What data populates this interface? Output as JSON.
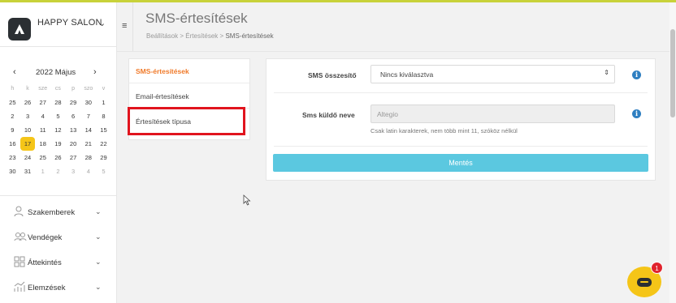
{
  "brand": {
    "name": "HAPPY SALON"
  },
  "calendar": {
    "title": "2022 Május",
    "weekdays": [
      "h",
      "k",
      "sze",
      "cs",
      "p",
      "szo",
      "v"
    ],
    "days": [
      {
        "d": "25",
        "muted": false
      },
      {
        "d": "26",
        "muted": false
      },
      {
        "d": "27",
        "muted": false
      },
      {
        "d": "28",
        "muted": false
      },
      {
        "d": "29",
        "muted": false
      },
      {
        "d": "30",
        "muted": false
      },
      {
        "d": "1",
        "muted": false
      },
      {
        "d": "2"
      },
      {
        "d": "3"
      },
      {
        "d": "4"
      },
      {
        "d": "5"
      },
      {
        "d": "6"
      },
      {
        "d": "7"
      },
      {
        "d": "8"
      },
      {
        "d": "9"
      },
      {
        "d": "10"
      },
      {
        "d": "11"
      },
      {
        "d": "12"
      },
      {
        "d": "13"
      },
      {
        "d": "14"
      },
      {
        "d": "15"
      },
      {
        "d": "16"
      },
      {
        "d": "17",
        "today": true
      },
      {
        "d": "18"
      },
      {
        "d": "19"
      },
      {
        "d": "20"
      },
      {
        "d": "21"
      },
      {
        "d": "22"
      },
      {
        "d": "23"
      },
      {
        "d": "24"
      },
      {
        "d": "25"
      },
      {
        "d": "26"
      },
      {
        "d": "27"
      },
      {
        "d": "28"
      },
      {
        "d": "29"
      },
      {
        "d": "30"
      },
      {
        "d": "31"
      },
      {
        "d": "1",
        "muted": true
      },
      {
        "d": "2",
        "muted": true
      },
      {
        "d": "3",
        "muted": true
      },
      {
        "d": "4",
        "muted": true
      },
      {
        "d": "5",
        "muted": true
      }
    ]
  },
  "nav": {
    "items": [
      {
        "label": "Szakemberek",
        "icon": "person-icon"
      },
      {
        "label": "Vendégek",
        "icon": "people-icon"
      },
      {
        "label": "Áttekintés",
        "icon": "grid-icon"
      },
      {
        "label": "Elemzések",
        "icon": "analytics-icon"
      }
    ]
  },
  "header": {
    "title": "SMS-értesítések",
    "breadcrumb": [
      "Beállítások",
      "Értesítések",
      "SMS-értesítések"
    ],
    "separator": ">"
  },
  "settings_menu": {
    "items": [
      "SMS-értesítések",
      "Email-értesítések",
      "Értesítések típusa"
    ],
    "active_index": 0
  },
  "form": {
    "sms_summary_label": "SMS összesítő",
    "sms_summary_value": "Nincs kiválasztva",
    "sender_name_label": "Sms küldő neve",
    "sender_name_value": "Altegio",
    "sender_name_hint": "Csak latin karakterek, nem több mint 11, szóköz nélkül",
    "save_label": "Mentés"
  },
  "chat": {
    "badge": "1"
  },
  "colors": {
    "accent_orange": "#f07a2a",
    "save_button": "#5bc8e0",
    "today": "#f5c518",
    "info": "#2f7fc1",
    "highlight_red": "#e1141e"
  }
}
